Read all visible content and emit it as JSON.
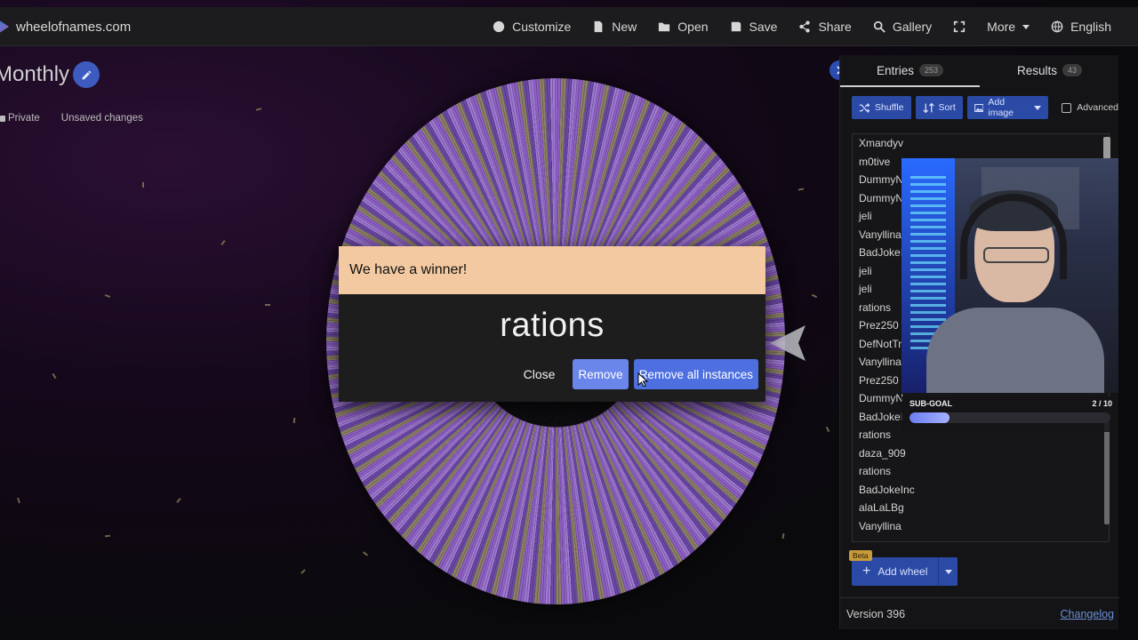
{
  "site": {
    "name": "wheelofnames.com"
  },
  "nav": {
    "customize": "Customize",
    "new": "New",
    "open": "Open",
    "save": "Save",
    "share": "Share",
    "gallery": "Gallery",
    "more": "More",
    "language": "English"
  },
  "wheel": {
    "title": "Monthly",
    "visibility": "Private",
    "status": "Unsaved changes",
    "colors": [
      "#9060c8",
      "#8e8464",
      "#6c48a8",
      "#a07ad4"
    ]
  },
  "modal": {
    "header": "We have a winner!",
    "winner": "rations",
    "close_label": "Close",
    "remove_label": "Remove",
    "remove_all_label": "Remove all instances",
    "header_color": "#f2c9a0",
    "button_color": "#4d6fe0"
  },
  "panel": {
    "tabs": [
      {
        "label": "Entries",
        "count": "253"
      },
      {
        "label": "Results",
        "count": "43"
      }
    ],
    "toolbar": {
      "shuffle": "Shuffle",
      "sort": "Sort",
      "add_image": "Add image",
      "advanced": "Advanced"
    },
    "entries": [
      "Xmandyv",
      "m0tive",
      "DummyN",
      "DummyN",
      "jeli",
      "Vanyllina",
      "BadJokeI",
      "jeli",
      "jeli",
      "rations",
      "Prez250",
      "DefNotTr",
      "Vanyllina",
      "Prez250",
      "DummyN",
      "BadJokeI",
      "rations",
      "daza_909",
      "rations",
      "BadJokeInc",
      "alaLaLBg",
      "Vanyllina"
    ],
    "add_wheel": "Add wheel",
    "beta": "Beta",
    "version": "Version 396",
    "changelog": "Changelog"
  },
  "overlay": {
    "subgoal_label": "SUB-GOAL",
    "subgoal_value": "2 / 10",
    "subgoal_progress": 0.2
  }
}
